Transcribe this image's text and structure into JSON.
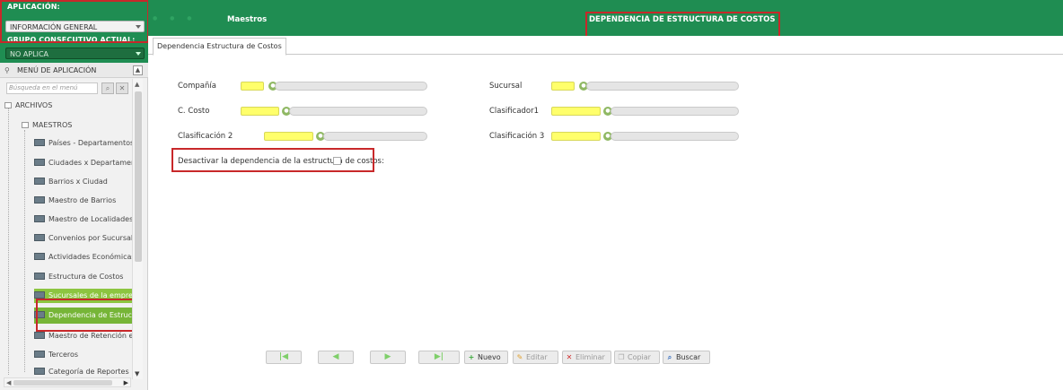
{
  "colors": {
    "brand_green": "#1f8d52",
    "highlight_green": "#76b537",
    "key_field_yellow": "#ffff6b",
    "annotation_red": "#c8282a"
  },
  "sidebar": {
    "app_label": "APLICACIÓN:",
    "app_value": "INFORMACIÓN GENERAL",
    "group_label": "GRUPO CONSECUTIVO ACTUAL:",
    "group_value": "NO APLICA",
    "menu_title": "MENÚ DE APLICACIÓN",
    "search_placeholder": "Búsqueda en el menú",
    "tree": {
      "root": "ARCHIVOS",
      "folder": "MAESTROS",
      "items": [
        {
          "label": "Países - Departamentos",
          "icon": "document-icon"
        },
        {
          "label": "Ciudades x Departamento",
          "icon": "document-icon"
        },
        {
          "label": "Barrios x Ciudad",
          "icon": "document-icon"
        },
        {
          "label": "Maestro de Barrios",
          "icon": "document-icon"
        },
        {
          "label": "Maestro de Localidades",
          "icon": "document-icon"
        },
        {
          "label": "Convenios por Sucursal",
          "icon": "document-icon"
        },
        {
          "label": "Actividades Económicas",
          "icon": "document-icon"
        },
        {
          "label": "Estructura de Costos",
          "icon": "document-icon"
        },
        {
          "label": "Sucursales de la empresa",
          "icon": "document-icon"
        },
        {
          "label": "Dependencia de Estructur",
          "icon": "document-icon",
          "selected": true
        },
        {
          "label": "Maestro de Retención en",
          "icon": "document-icon"
        },
        {
          "label": "Terceros",
          "icon": "document-icon"
        },
        {
          "label": "Categoría de Reportes",
          "icon": "document-icon"
        }
      ]
    }
  },
  "header": {
    "module": "Maestros",
    "title": "DEPENDENCIA DE ESTRUCTURA DE COSTOS"
  },
  "tabs": [
    {
      "label": "Dependencia Estructura de Costos"
    }
  ],
  "form": {
    "compania_label": "Compañía",
    "sucursal_label": "Sucursal",
    "costo_label": "C. Costo",
    "clasificador1_label": "Clasificador1",
    "clasificacion2_label": "Clasificación 2",
    "clasificacion3_label": "Clasificación 3",
    "deactivate_label": "Desactivar la dependencia de la estructura de costos:",
    "deactivate_checked": false
  },
  "toolbar": {
    "nuevo": "Nuevo",
    "editar": "Editar",
    "eliminar": "Eliminar",
    "copiar": "Copiar",
    "buscar": "Buscar"
  }
}
